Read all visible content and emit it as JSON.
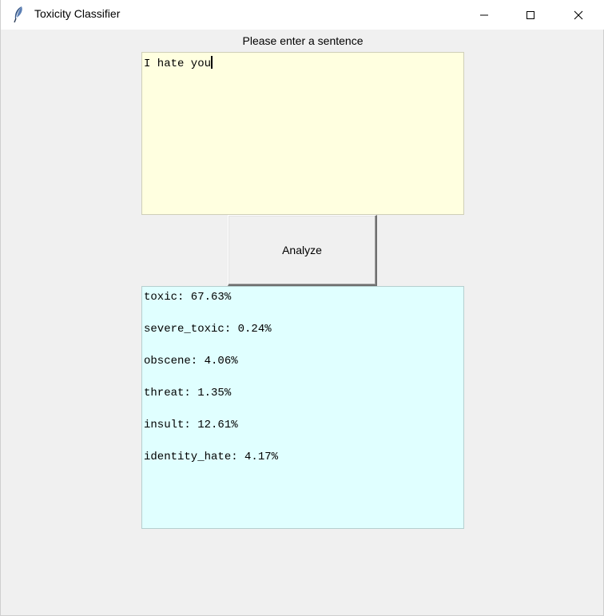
{
  "window": {
    "title": "Toxicity Classifier"
  },
  "prompt": {
    "label": "Please enter a sentence"
  },
  "input": {
    "value": "I hate you"
  },
  "analyze_button": {
    "label": "Analyze"
  },
  "results": [
    {
      "text": "toxic: 67.63%"
    },
    {
      "text": "severe_toxic: 0.24%"
    },
    {
      "text": "obscene: 4.06%"
    },
    {
      "text": "threat: 1.35%"
    },
    {
      "text": "insult: 12.61%"
    },
    {
      "text": "identity_hate: 4.17%"
    }
  ],
  "colors": {
    "input_background": "#ffffe0",
    "output_background": "#e0ffff",
    "window_background": "#f0f0f0"
  },
  "icons": {
    "app": "feather-icon",
    "minimize": "minimize-icon",
    "maximize": "maximize-icon",
    "close": "close-icon"
  }
}
